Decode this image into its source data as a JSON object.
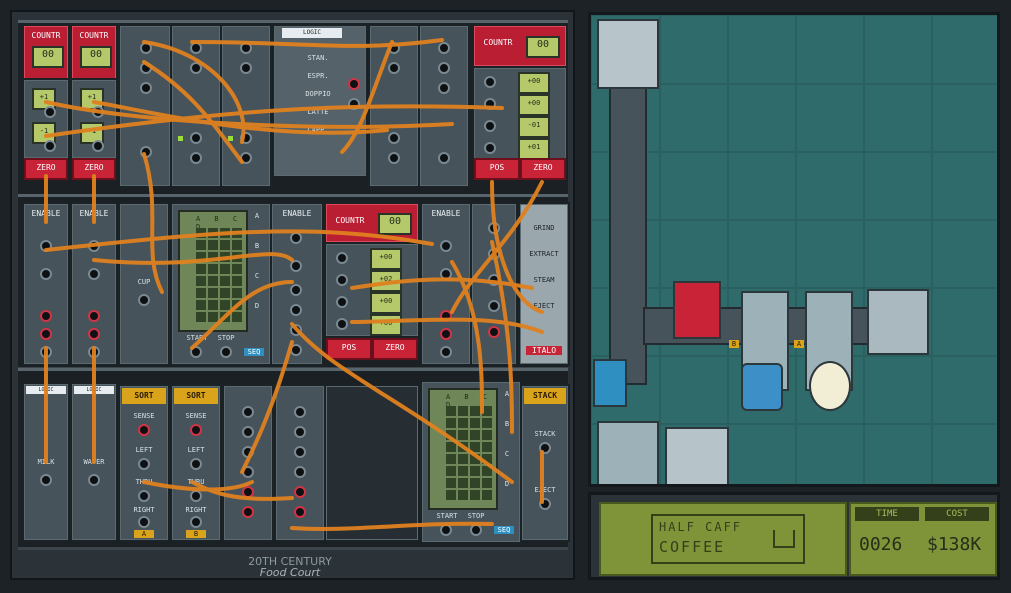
{
  "rack": {
    "top_row": {
      "counter_left_1": {
        "title": "COUNTR",
        "value": "00"
      },
      "counter_left_2": {
        "title": "COUNTR",
        "value": "00"
      },
      "counter_left_buttons": [
        "+1",
        "-1",
        "+1",
        "-1"
      ],
      "zero_left_1": "ZERO",
      "zero_left_2": "ZERO",
      "logic_label": "LOGIC",
      "menu_items": [
        "STAN.",
        "ESPR.",
        "DOPPIO",
        "LATTE",
        "CAPP."
      ],
      "counter_right": {
        "title": "COUNTR",
        "value": "00"
      },
      "counter_right_values": [
        "+00",
        "+00",
        "-01",
        "+01"
      ],
      "pos_label": "POS",
      "zero_right": "ZERO"
    },
    "middle_row": {
      "enable_1": "ENABLE",
      "enable_2": "ENABLE",
      "cup_label": "CUP",
      "grid_cols": "A B C D",
      "seq_rows": [
        "A",
        "B",
        "C",
        "D"
      ],
      "start": "START",
      "stop": "STOP",
      "seq_badge": "SEQ",
      "enable_3": "ENABLE",
      "counter_mid": {
        "title": "COUNTR",
        "value": "00"
      },
      "counter_mid_values": [
        "+00",
        "+02",
        "+00",
        "+00"
      ],
      "pos_mid": "POS",
      "zero_mid": "ZERO",
      "enable_4": "ENABLE",
      "italo_actions": [
        "GRIND",
        "EXTRACT",
        "STEAM",
        "EJECT"
      ],
      "italo_badge": "ITALO"
    },
    "bottom_row": {
      "logic_1": "LOGIC",
      "logic_2": "LOGIC",
      "milk": "MILK",
      "water": "WATER",
      "sort_1": {
        "title": "SORT",
        "labels": [
          "SENSE",
          "LEFT",
          "THRU",
          "RIGHT"
        ],
        "tag": "A"
      },
      "sort_2": {
        "title": "SORT",
        "labels": [
          "SENSE",
          "LEFT",
          "THRU",
          "RIGHT"
        ],
        "tag": "B"
      },
      "grid_cols": "A B C D",
      "seq_rows": [
        "A",
        "B",
        "C",
        "D"
      ],
      "start": "START",
      "stop": "STOP",
      "seq_badge": "SEQ",
      "stack": {
        "title": "STACK",
        "labels": [
          "STACK",
          "EJECT"
        ]
      }
    }
  },
  "footer_logo": {
    "line1": "20TH CENTURY",
    "line2": "Food Court"
  },
  "factory": {
    "markers": [
      "B",
      "A"
    ]
  },
  "display": {
    "brand_line1": "HALF CAFF",
    "brand_line2": "COFFEE",
    "time_label": "TIME",
    "cost_label": "COST",
    "time_value": "0026",
    "cost_value": "$138K"
  },
  "colors": {
    "wire": "#e0811f",
    "accent_red": "#c82337",
    "lcd": "#b5c86a",
    "floor": "#2f6b6a"
  }
}
